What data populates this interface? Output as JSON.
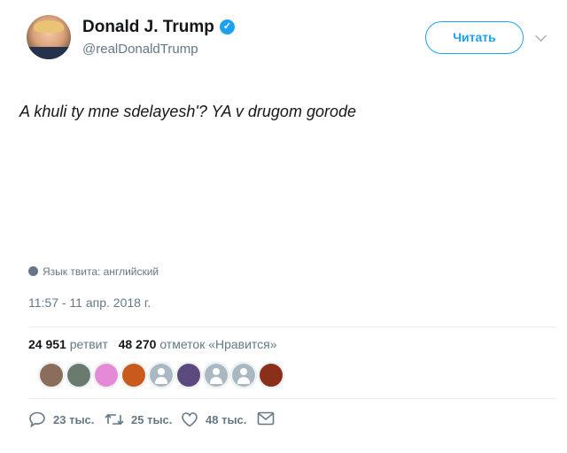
{
  "header": {
    "display_name": "Donald J. Trump",
    "handle": "@realDonaldTrump",
    "follow_label": "Читать"
  },
  "tweet": {
    "text": "A khuli ty mne sdelayesh'? YA v drugom gorode",
    "language_label": "Язык твита: английский",
    "timestamp": "11:57 - 11 апр. 2018 г."
  },
  "stats": {
    "retweets_count": "24 951",
    "retweets_label": "ретвит",
    "likes_count": "48 270",
    "likes_label": "отметок «Нравится»"
  },
  "likers": [
    {
      "color": "#8a6d5a"
    },
    {
      "color": "#6b7a6f"
    },
    {
      "color": "#e58ad6"
    },
    {
      "color": "#c85a1e"
    },
    {
      "color": "default"
    },
    {
      "color": "#5b4a7e"
    },
    {
      "color": "default"
    },
    {
      "color": "default"
    },
    {
      "color": "#8b2e1a"
    }
  ],
  "actions": {
    "replies": "23 тыс.",
    "retweets": "25 тыс.",
    "likes": "48 тыс."
  },
  "colors": {
    "accent": "#1da1f2",
    "muted": "#657786"
  }
}
